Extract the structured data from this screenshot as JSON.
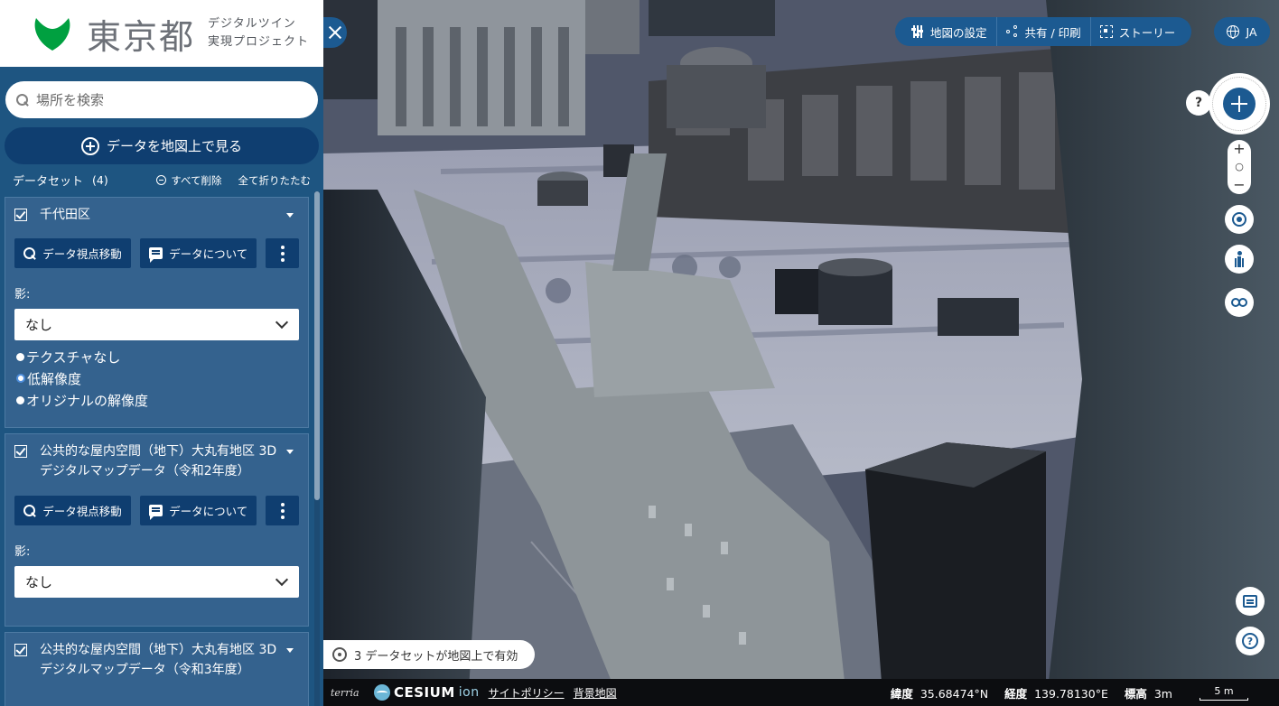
{
  "brand": {
    "logo_name": "東京都",
    "subtitle_line1": "デジタルツイン",
    "subtitle_line2": "実現プロジェクト",
    "leaf_color": "#00a040"
  },
  "search": {
    "placeholder": "場所を検索"
  },
  "view_data_button": "データを地図上で見る",
  "datasets": {
    "title": "データセット",
    "count": "(4)",
    "clear_all": "すべて削除",
    "collapse_all": "全て折りたたむ",
    "items": [
      {
        "name": "千代田区",
        "view_button": "データ視点移動",
        "about_button": "データについて",
        "shadow_label": "影:",
        "shadow_value": "なし",
        "options": [
          "テクスチャなし",
          "低解像度",
          "オリジナルの解像度"
        ],
        "selected_option": "低解像度"
      },
      {
        "name": "公共的な屋内空間（地下）大丸有地区 3Dデジタルマップデータ（令和2年度）",
        "view_button": "データ視点移動",
        "about_button": "データについて",
        "shadow_label": "影:",
        "shadow_value": "なし"
      },
      {
        "name": "公共的な屋内空間（地下）大丸有地区 3Dデジタルマップデータ（令和3年度）"
      }
    ]
  },
  "topmenu": {
    "map_settings": "地図の設定",
    "share_print": "共有 / 印刷",
    "story": "ストーリー",
    "language": "JA"
  },
  "nav": {
    "help_q": "?",
    "zoom_in": "+",
    "zoom_reset": "○",
    "zoom_out": "−",
    "help_icon": "?"
  },
  "status": {
    "active_text": "3 データセットが地図上で有効"
  },
  "bottom": {
    "terria": "terria",
    "cesium": "CESIUM",
    "ion": "ion",
    "site_policy": "サイトポリシー",
    "basemap": "背景地図",
    "lat_label": "緯度",
    "lat_value": "35.68474°N",
    "lon_label": "経度",
    "lon_value": "139.78130°E",
    "alt_label": "標高",
    "alt_value": "3m",
    "scale": "5 m"
  },
  "colors": {
    "sidebar": "#1e5581",
    "button_dark": "#0f3e70",
    "card": "#34628e",
    "map_control": "#1c5a91"
  }
}
